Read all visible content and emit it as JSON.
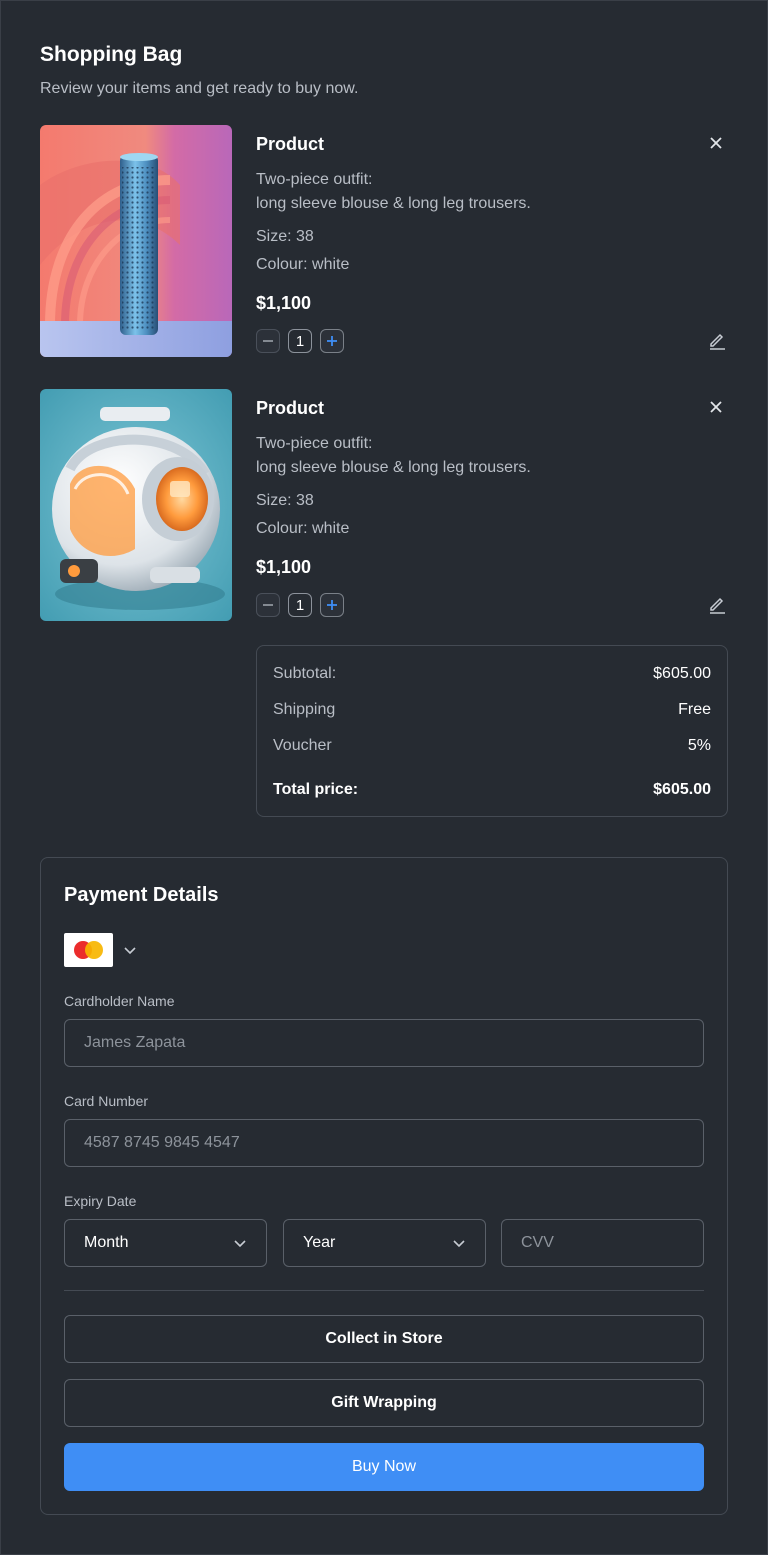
{
  "header": {
    "title": "Shopping Bag",
    "subtitle": "Review your items and get ready to buy now."
  },
  "items": [
    {
      "name": "Product",
      "desc_line1": "Two-piece outfit:",
      "desc_line2": "long sleeve blouse & long leg trousers.",
      "size": "Size: 38",
      "colour": "Colour: white",
      "price": "$1,100",
      "quantity": "1",
      "image_icon": "speaker-product-image"
    },
    {
      "name": "Product",
      "desc_line1": "Two-piece outfit:",
      "desc_line2": "long sleeve blouse & long leg trousers.",
      "size": "Size: 38",
      "colour": "Colour: white",
      "price": "$1,100",
      "quantity": "1",
      "image_icon": "robot-device-product-image"
    }
  ],
  "summary": {
    "subtotal_label": "Subtotal:",
    "subtotal_value": "$605.00",
    "shipping_label": "Shipping",
    "shipping_value": "Free",
    "voucher_label": "Voucher",
    "voucher_value": "5%",
    "total_label": "Total price:",
    "total_value": "$605.00"
  },
  "payment": {
    "title": "Payment Details",
    "card_icon": "mastercard-icon",
    "cardholder_label": "Cardholder Name",
    "cardholder_placeholder": "James Zapata",
    "card_number_label": "Card Number",
    "card_number_placeholder": "4587 8745 9845 4547",
    "expiry_label": "Expiry Date",
    "month_value": "Month",
    "year_value": "Year",
    "cvv_placeholder": "CVV",
    "collect_label": "Collect in Store",
    "gift_label": "Gift Wrapping",
    "buy_label": "Buy Now"
  },
  "colors": {
    "background": "#262b32",
    "accent": "#3f8ef5",
    "border": "#444a53",
    "text_primary": "#ffffff",
    "text_secondary": "#b9bec6"
  }
}
